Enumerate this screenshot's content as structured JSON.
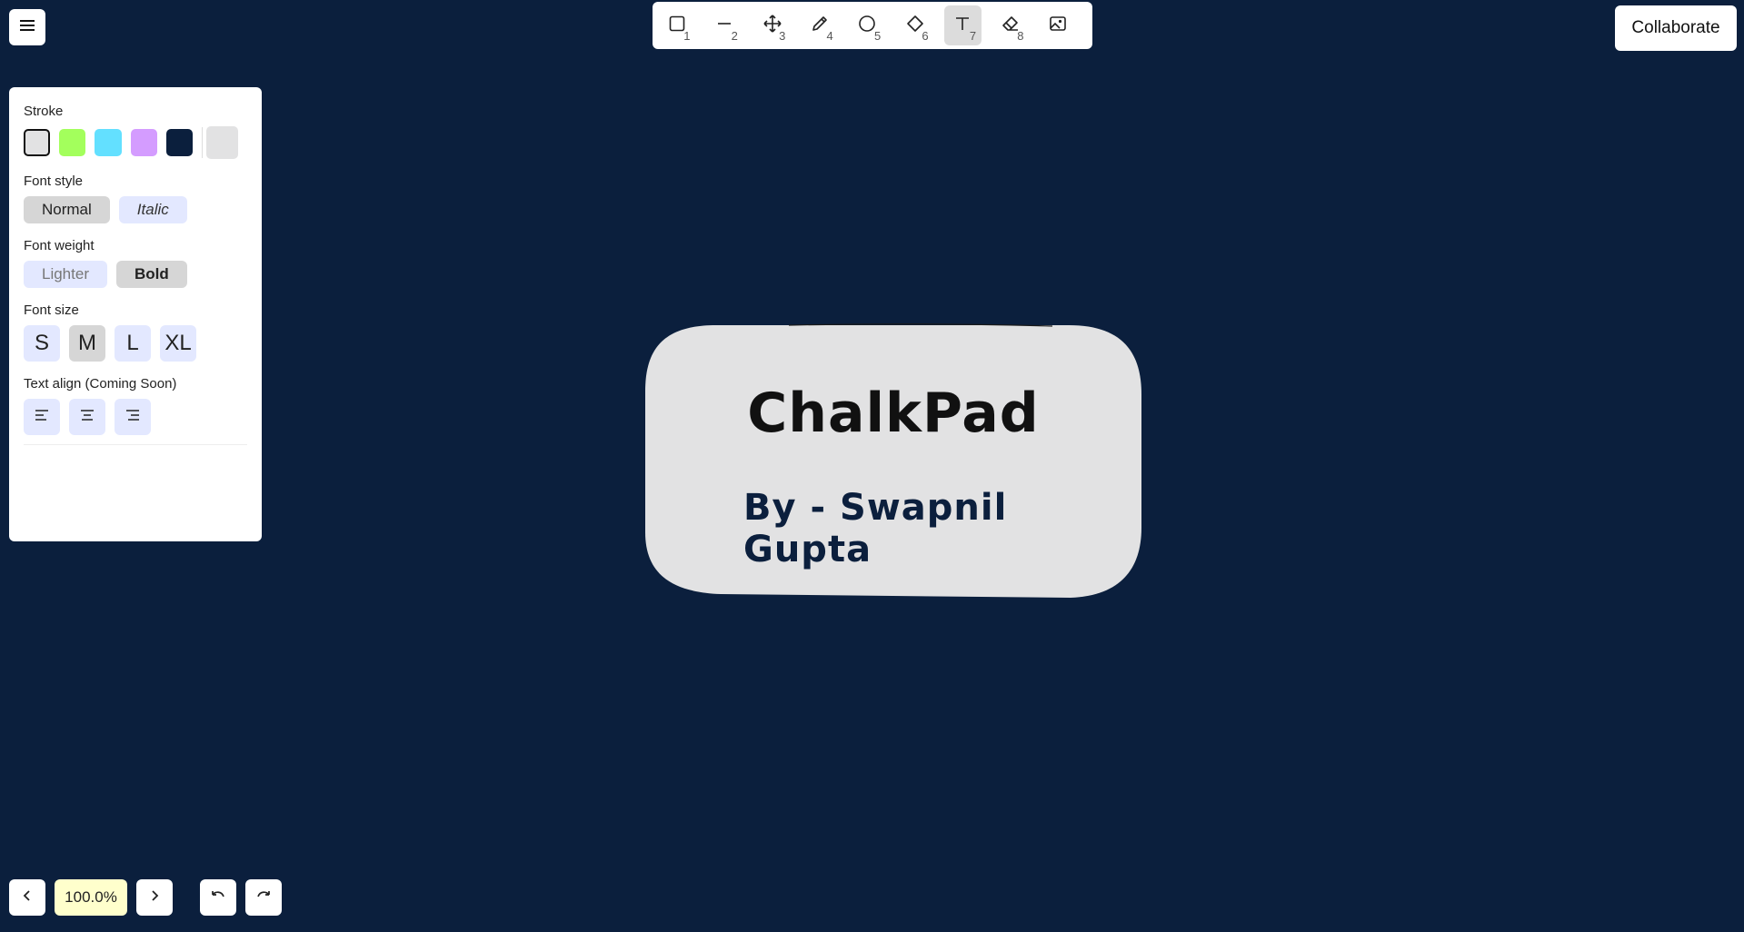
{
  "colors": {
    "canvas_bg": "#0b1f3d",
    "card_fill": "#e2e2e3",
    "zoom_bg": "#ffffcc"
  },
  "menu": {
    "icon": "hamburger-menu-icon"
  },
  "toolbar": {
    "tools": [
      {
        "icon": "rectangle-icon",
        "key": "1"
      },
      {
        "icon": "line-icon",
        "key": "2"
      },
      {
        "icon": "move-icon",
        "key": "3"
      },
      {
        "icon": "pencil-icon",
        "key": "4"
      },
      {
        "icon": "circle-icon",
        "key": "5"
      },
      {
        "icon": "diamond-icon",
        "key": "6"
      },
      {
        "icon": "text-icon",
        "key": "7",
        "active": true
      },
      {
        "icon": "eraser-icon",
        "key": "8"
      },
      {
        "icon": "image-icon",
        "key": ""
      }
    ]
  },
  "collaborate_label": "Collaborate",
  "panel": {
    "stroke_label": "Stroke",
    "stroke_colors": [
      "#e2e2e3",
      "#a3ff5c",
      "#63e0ff",
      "#d49cff",
      "#0b1f3d"
    ],
    "custom_color": "#e2e2e3",
    "font_style_label": "Font style",
    "font_style_options": [
      "Normal",
      "Italic"
    ],
    "font_weight_label": "Font weight",
    "font_weight_options": [
      "Lighter",
      "Bold"
    ],
    "font_size_label": "Font size",
    "font_size_options": [
      "S",
      "M",
      "L",
      "XL"
    ],
    "text_align_label": "Text align (Coming Soon)",
    "text_align_icons": [
      "align-left-icon",
      "align-center-icon",
      "align-right-icon"
    ]
  },
  "card": {
    "title": "ChalkPad",
    "subtitle": "By - Swapnil Gupta"
  },
  "bottom": {
    "zoom": "100.0%",
    "prev_icon": "chevron-left-icon",
    "next_icon": "chevron-right-icon",
    "undo_icon": "undo-icon",
    "redo_icon": "redo-icon"
  }
}
